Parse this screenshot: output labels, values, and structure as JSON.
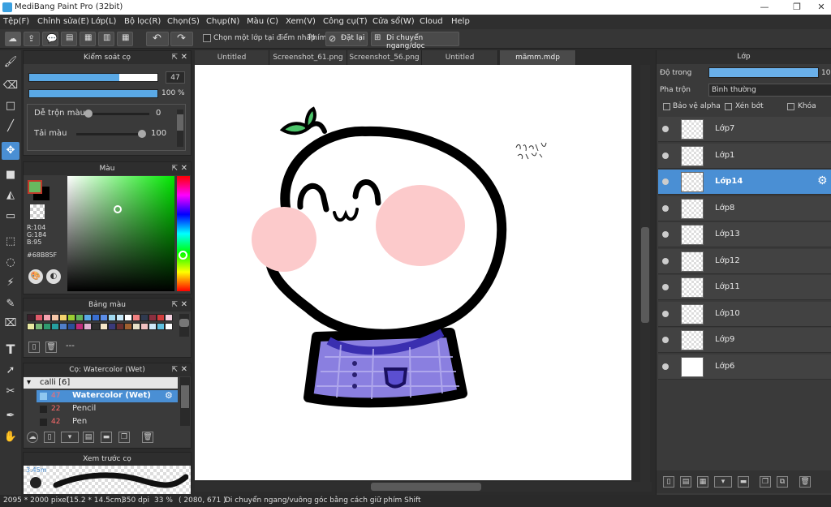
{
  "window": {
    "title": "MediBang Paint Pro (32bit)"
  },
  "menu": [
    "Tệp(F)",
    "Chỉnh sửa(E)",
    "Lớp(L)",
    "Bộ lọc(R)",
    "Chọn(S)",
    "Chụp(N)",
    "Màu (C)",
    "Xem(V)",
    "Công cụ(T)",
    "Cửa sổ(W)",
    "Cloud",
    "Help"
  ],
  "toolbar": {
    "select_one_layer": "Chọn một lớp tại điểm nhấp",
    "key_label": "Phím",
    "reset_label": "Đặt lại",
    "move_hv_label": "Di chuyển ngang/dọc"
  },
  "brush_control": {
    "title": "Kiểm soát cọ",
    "size": "47",
    "size_fraction": 0.7,
    "opacity": "100 %",
    "opacity_fraction": 1.0,
    "blend_label": "Dễ trộn màu",
    "blend_value": "0",
    "blend_fraction": 0.0,
    "amount_label": "Tải màu",
    "amount_value": "100",
    "amount_fraction": 1.0
  },
  "color": {
    "title": "Màu",
    "r": "R:104",
    "g": "G:184",
    "b": "B:95",
    "hex": "#68B85F",
    "fg": "#68b85f"
  },
  "palette": {
    "title": "Bảng màu",
    "colors": [
      "#3a1f2a",
      "#e05a6a",
      "#f5a3b0",
      "#f6c7a8",
      "#f3d26d",
      "#9acd32",
      "#63b55c",
      "#5aa9e6",
      "#3a6fd0",
      "#5b8de8",
      "#a0d8f0",
      "#c7e7f7",
      "#ffffff",
      "#f08080",
      "#2f3a50",
      "#8a2f3f",
      "#d23c3c",
      "#f5d0e0",
      "#e8e8a0",
      "#7aba7a",
      "#2f9a6f",
      "#26a0a0",
      "#4f7ec8",
      "#2a4f99",
      "#c02a7a",
      "#e0b0d0",
      "#303030",
      "#f5e6c8",
      "#3a3a7a",
      "#6a2f2f",
      "#a06030",
      "#e6e0c8",
      "#f0c0c0",
      "#d0e8f8",
      "#5fc0e0",
      "#ffffff"
    ],
    "footer": "---"
  },
  "brushes": {
    "title": "Cọ: Watercolor (Wet)",
    "group": "calli [6]",
    "items": [
      {
        "size": "47",
        "name": "Watercolor (Wet)"
      },
      {
        "size": "22",
        "name": "Pencil"
      },
      {
        "size": "42",
        "name": "Pen"
      }
    ]
  },
  "preview": {
    "title": "Xem trước cọ",
    "size": "3.45m"
  },
  "tabs": [
    "Untitled",
    "Screenshot_61.png",
    "Screenshot_56.png",
    "Untitled",
    "mămm.mdp"
  ],
  "active_tab": 4,
  "layers_panel": {
    "title": "Lớp",
    "opacity_label": "Độ trong",
    "opacity_value": "100",
    "blend_label": "Pha trộn",
    "blend_value": "Bình thường",
    "protect_alpha": "Bảo vệ alpha",
    "clipping": "Xén bớt",
    "lock": "Khóa",
    "layers": [
      "Lớp7",
      "Lớp1",
      "Lớp14",
      "Lớp8",
      "Lớp13",
      "Lớp12",
      "Lớp11",
      "Lớp10",
      "Lớp9",
      "Lớp6"
    ],
    "selected": 2
  },
  "status": {
    "size": "2095 * 2000 pixel",
    "cm": "(15.2 * 14.5cm)",
    "dpi": "350 dpi",
    "zoom": "33 %",
    "coords": "( 2080, 671 )",
    "hint": "Di chuyển ngang/vuông góc bằng cách giữ phím Shift"
  },
  "signature": "Dyhanh14 4/9/24",
  "colors": {
    "accent": "#4a8fd4",
    "panel": "#3a3a3a",
    "dark": "#2b2b2b",
    "shirt": "#6a5acd"
  }
}
